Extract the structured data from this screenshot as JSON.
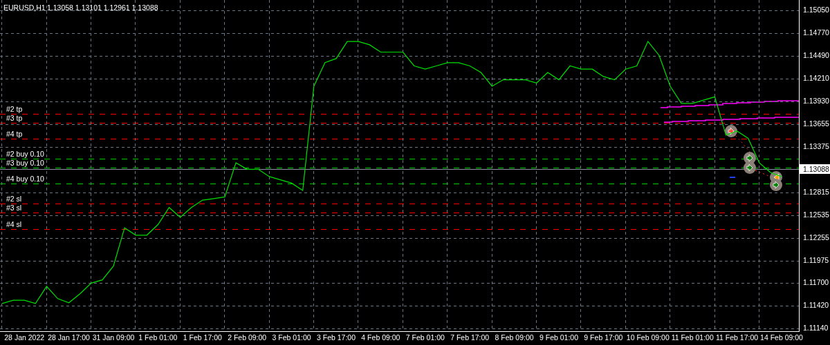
{
  "header": {
    "quotes": [
      "1.13058",
      "1.13101",
      "1.12961",
      "1.13088"
    ]
  },
  "chart": {
    "chart_data": {
      "type": "line",
      "title": "EURUSD,H1",
      "grid": true,
      "ylim": [
        1.1111,
        1.1518
      ],
      "categories": [
        null,
        null,
        "28 Jan 2022",
        null,
        null,
        null,
        "28 Jan 17:00",
        null,
        null,
        null,
        "31 Jan 09:00",
        null,
        null,
        null,
        "1 Feb 01:00",
        null,
        null,
        null,
        "1 Feb 17:00",
        null,
        null,
        null,
        "2 Feb 09:00",
        null,
        null,
        null,
        "3 Feb 01:00",
        null,
        null,
        null,
        "3 Feb 17:00",
        null,
        null,
        null,
        "4 Feb 09:00",
        null,
        null,
        null,
        "7 Feb 01:00",
        null,
        null,
        null,
        "7 Feb 17:00",
        null,
        null,
        null,
        "8 Feb 09:00",
        null,
        null,
        null,
        "9 Feb 01:00",
        null,
        null,
        null,
        "9 Feb 17:00",
        null,
        null,
        null,
        "10 Feb 09:00",
        null,
        null,
        null,
        "11 Feb 01:00",
        null,
        null,
        null,
        "11 Feb 17:00",
        null,
        null,
        null,
        "14 Feb 09:00"
      ],
      "series": [
        {
          "color": "#00e000",
          "values": [
            1.1145,
            1.1149,
            1.1149,
            1.1145,
            1.1166,
            1.1151,
            1.1146,
            1.1157,
            1.117,
            1.1174,
            1.1191,
            1.1238,
            1.1229,
            1.1229,
            1.1242,
            1.1263,
            1.1251,
            1.1263,
            1.1272,
            1.1274,
            1.1276,
            1.1318,
            1.131,
            1.131,
            1.1301,
            1.1297,
            1.1293,
            1.1284,
            1.1412,
            1.1441,
            1.1446,
            1.1467,
            1.1467,
            1.1463,
            1.1454,
            1.1454,
            1.1454,
            1.1437,
            1.1433,
            1.1437,
            1.1441,
            1.1441,
            1.1437,
            1.1429,
            1.1412,
            1.142,
            1.142,
            1.142,
            1.1416,
            1.1429,
            1.142,
            1.1437,
            1.1433,
            1.1433,
            1.1424,
            1.142,
            1.1433,
            1.1437,
            1.1467,
            1.145,
            1.1412,
            1.1391,
            1.1391,
            1.1395,
            1.1399,
            1.1352,
            1.1357,
            1.1348,
            1.1318,
            1.1306,
            1.1301
          ]
        }
      ],
      "yticks": [
        {
          "value": 1.1505,
          "label": "1.15050"
        },
        {
          "value": 1.1477,
          "label": "1.14770"
        },
        {
          "value": 1.1449,
          "label": "1.14490"
        },
        {
          "value": 1.1421,
          "label": "1.14210"
        },
        {
          "value": 1.1393,
          "label": "1.13930"
        },
        {
          "value": 1.13655,
          "label": "1.13655"
        },
        {
          "value": 1.13375,
          "label": "1.13375"
        },
        {
          "value": 1.12815,
          "label": "1.12815"
        },
        {
          "value": 1.12535,
          "label": "1.12535"
        },
        {
          "value": 1.12255,
          "label": "1.12255"
        },
        {
          "value": 1.11975,
          "label": "1.11975"
        },
        {
          "value": 1.117,
          "label": "1.11700"
        },
        {
          "value": 1.1142,
          "label": "1.11420"
        },
        {
          "value": 1.1114,
          "label": "1.11140"
        }
      ]
    }
  },
  "current_price": "1.13088",
  "order_lines": [
    {
      "label": "#2 tp",
      "color": "#ff0000"
    },
    {
      "label": "#3 tp",
      "color": "#ff0000"
    },
    {
      "label": "#4 tp",
      "color": "#ff0000"
    },
    {
      "label": "#2 buy 0.10",
      "color": "#00d000"
    },
    {
      "label": "#3 buy 0.10",
      "color": "#00d000"
    },
    {
      "label": "#4 buy 0.10",
      "color": "#00d000"
    },
    {
      "label": "#2 sl",
      "color": "#ff0000"
    },
    {
      "label": "#3 sl",
      "color": "#ff0000"
    },
    {
      "label": "#4 sl",
      "color": "#ff0000"
    }
  ]
}
